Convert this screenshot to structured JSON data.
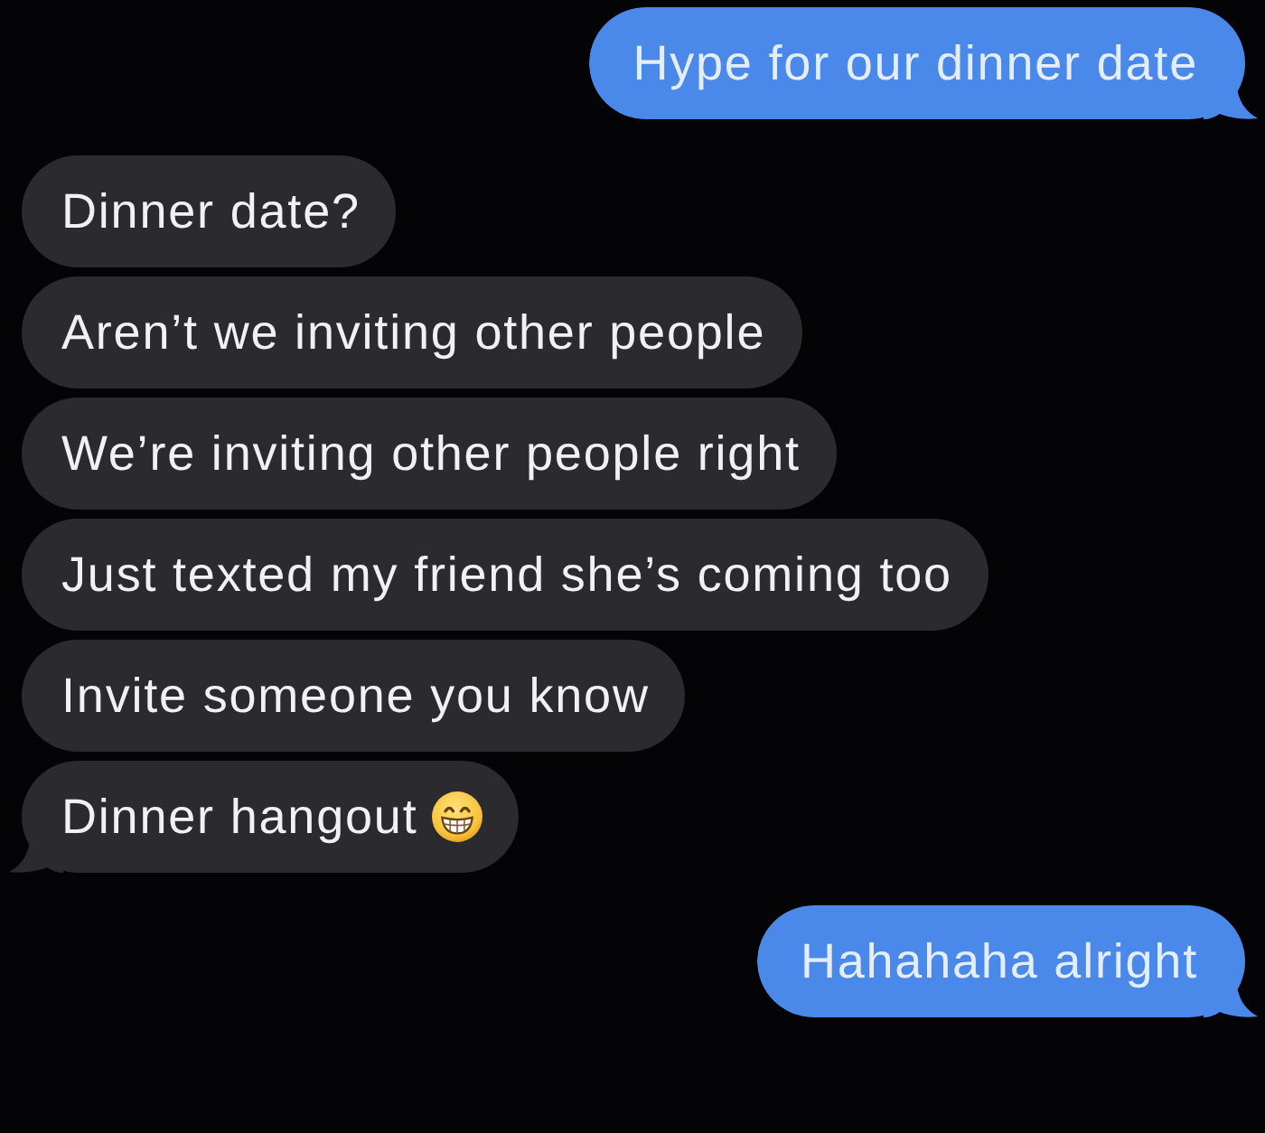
{
  "messages": [
    {
      "kind": "sent",
      "text": "Hype for our dinner date",
      "tail": true,
      "emoji": false
    },
    {
      "kind": "received",
      "text": "Dinner date?",
      "tail": false,
      "emoji": false
    },
    {
      "kind": "received",
      "text": "Aren’t we inviting other people",
      "tail": false,
      "emoji": false
    },
    {
      "kind": "received",
      "text": "We’re inviting other people right",
      "tail": false,
      "emoji": false
    },
    {
      "kind": "received",
      "text": "Just texted my friend she’s coming too",
      "tail": false,
      "emoji": false
    },
    {
      "kind": "received",
      "text": "Invite someone you know",
      "tail": false,
      "emoji": false
    },
    {
      "kind": "received",
      "text": "Dinner hangout",
      "tail": true,
      "emoji": true
    },
    {
      "kind": "sent",
      "text": "Hahahaha alright",
      "tail": true,
      "emoji": false
    }
  ]
}
